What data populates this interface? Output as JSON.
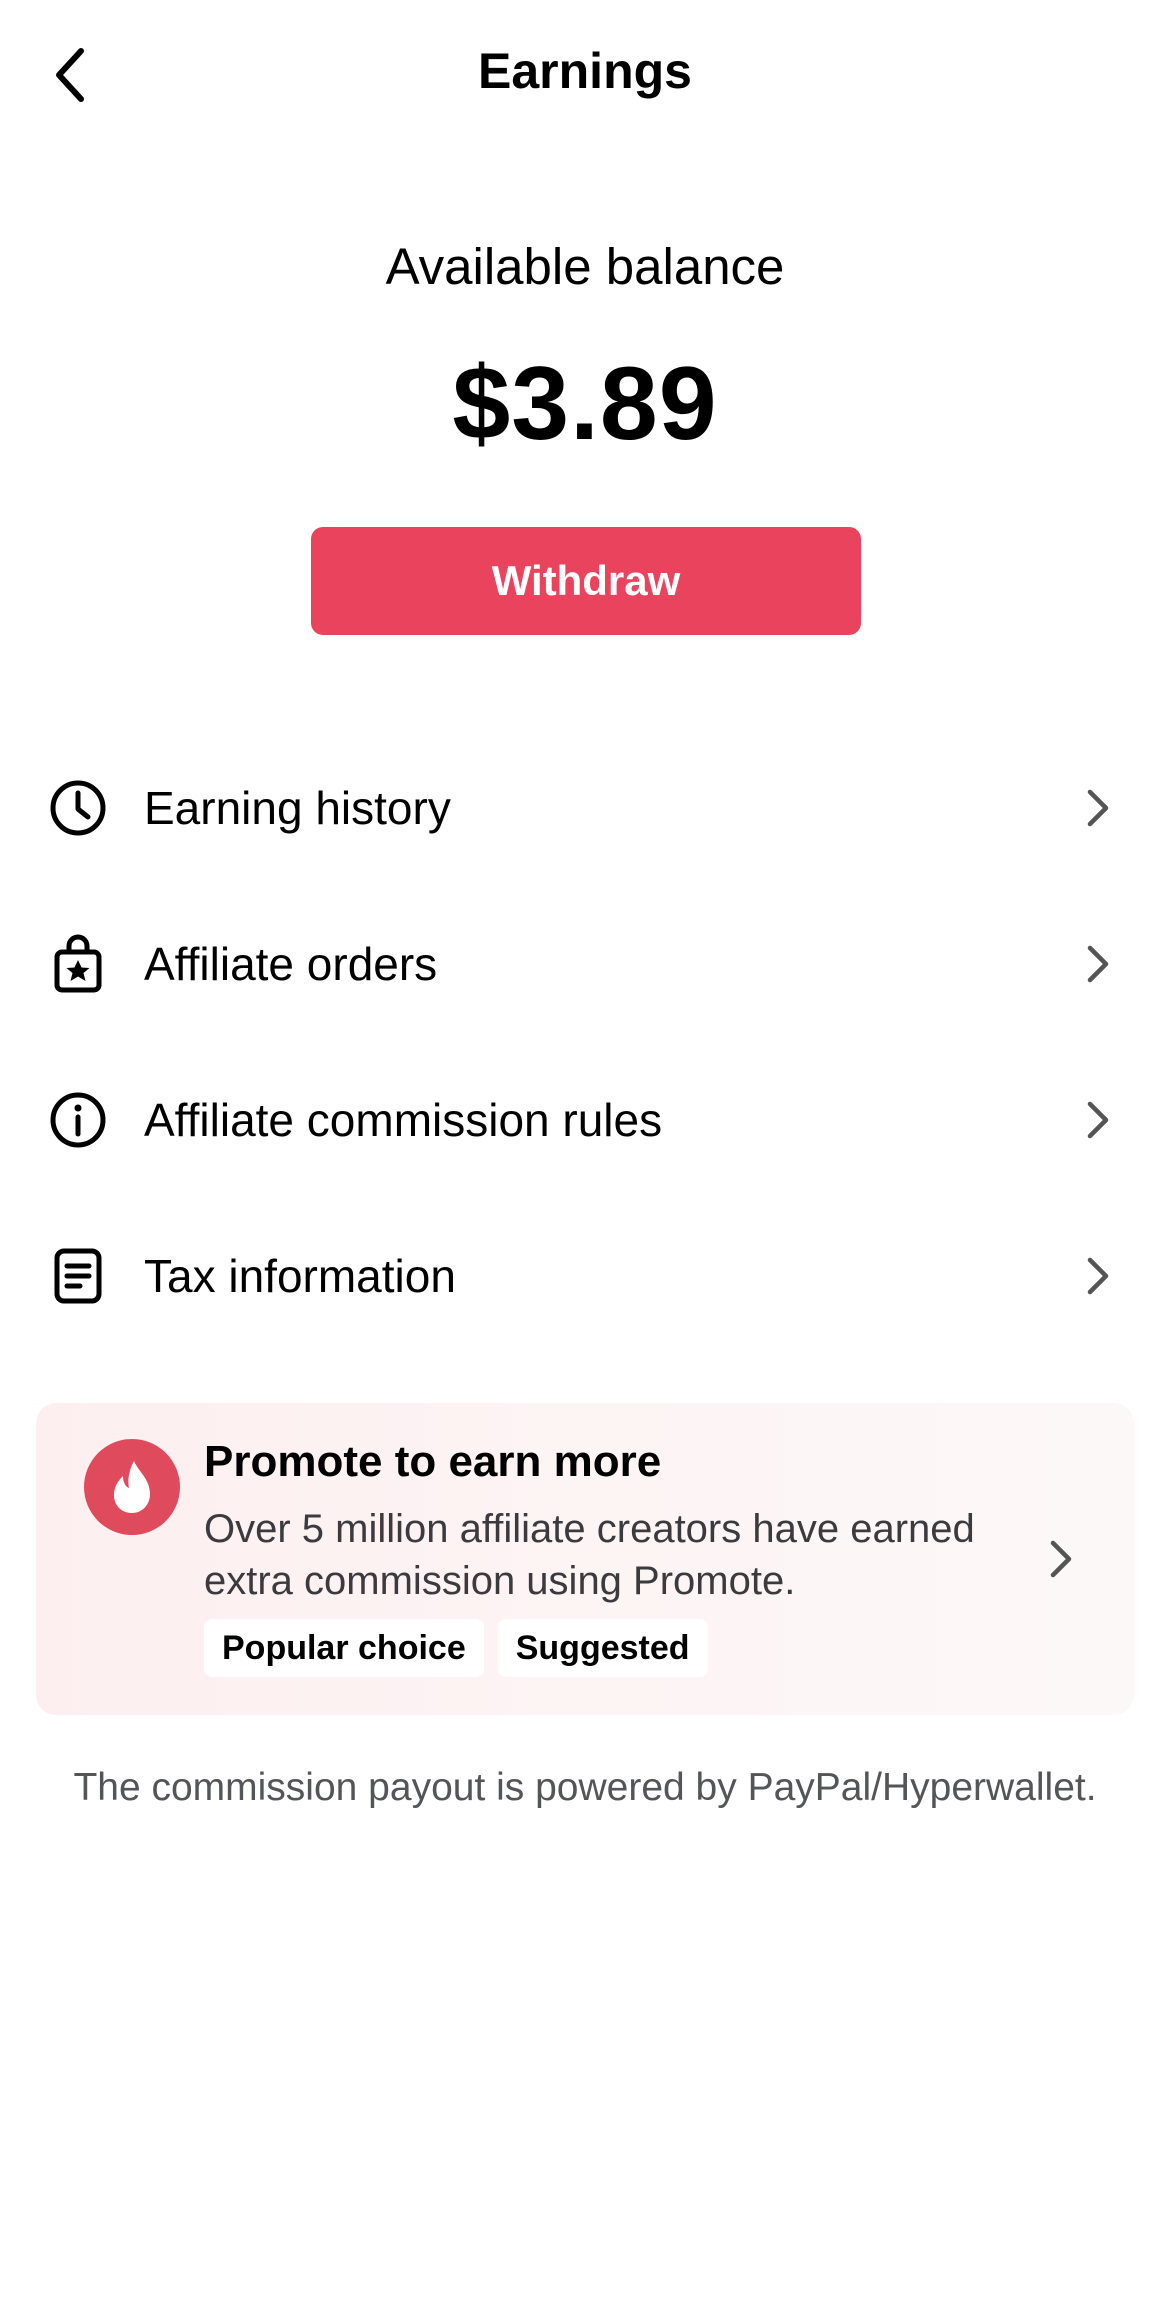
{
  "header": {
    "title": "Earnings",
    "back_icon": "chevron-left-icon"
  },
  "balance": {
    "label": "Available balance",
    "amount": "$3.89",
    "withdraw_label": "Withdraw"
  },
  "menu": {
    "items": [
      {
        "label": "Earning history",
        "icon": "clock-icon"
      },
      {
        "label": "Affiliate orders",
        "icon": "shopping-bag-star-icon"
      },
      {
        "label": "Affiliate commission rules",
        "icon": "info-circle-icon"
      },
      {
        "label": "Tax information",
        "icon": "document-icon"
      }
    ]
  },
  "promo": {
    "title": "Promote to earn more",
    "description": "Over 5 million affiliate creators have earned extra commission using Promote.",
    "tags": [
      "Popular choice",
      "Suggested"
    ],
    "icon": "flame-icon"
  },
  "footer": {
    "note": "The commission payout is powered by PayPal/Hyperwallet."
  },
  "colors": {
    "accent": "#ea435d",
    "promo_icon_bg": "#df4b5c",
    "promo_bg": "#fdf2f3",
    "secondary_text": "#545558"
  }
}
